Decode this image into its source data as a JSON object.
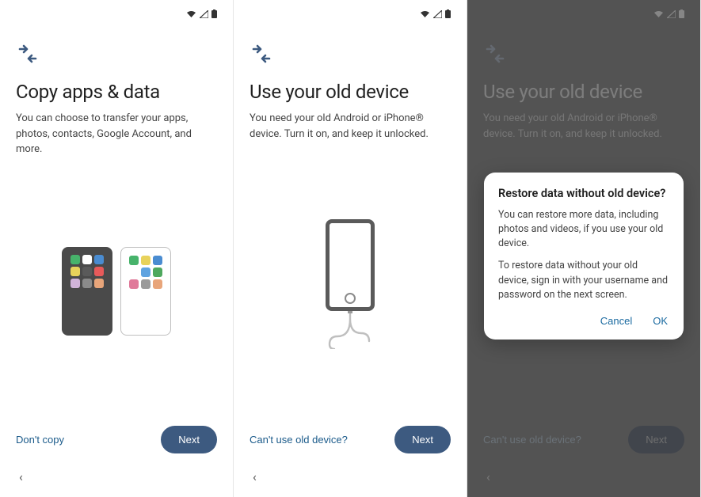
{
  "screens": [
    {
      "title": "Copy apps & data",
      "subtitle": "You can choose to transfer your apps, photos, contacts, Google Account, and more.",
      "secondary_action": "Don't copy",
      "primary_action": "Next"
    },
    {
      "title": "Use your old device",
      "subtitle": "You need your old Android or iPhone® device. Turn it on, and keep it unlocked.",
      "secondary_action": "Can't use old device?",
      "primary_action": "Next"
    },
    {
      "title": "Use your old device",
      "subtitle": "You need your old Android or iPhone® device. Turn it on, and keep it unlocked.",
      "secondary_action": "Can't use old device?",
      "primary_action": "Next"
    }
  ],
  "dialog": {
    "title": "Restore data without old device?",
    "body1": "You can restore more data, including photos and videos, if you use your old device.",
    "body2": "To restore data without your old device, sign in with your username and password on the next screen.",
    "cancel": "Cancel",
    "ok": "OK"
  },
  "icons": {
    "wifi": "wifi-icon",
    "signal": "signal-icon",
    "battery": "battery-icon",
    "brand": "transfer-arrows-icon",
    "back": "chevron-left-icon"
  },
  "app_icon_colors": {
    "dark_phone": [
      "#47b36b",
      "#ffffff",
      "#4a8cd1",
      "#e8d25b",
      "#5a5a5a",
      "#e85a5a",
      "#d1b4d9",
      "#8a8a8a",
      "#e8a57a"
    ],
    "light_phone": [
      "#47b36b",
      "#e8d25b",
      "#4a8cd1",
      "#ffffff",
      "#5fa3e0",
      "#4ea85e",
      "#e07a9a",
      "#9a9a9a",
      "#e8a57a"
    ]
  }
}
